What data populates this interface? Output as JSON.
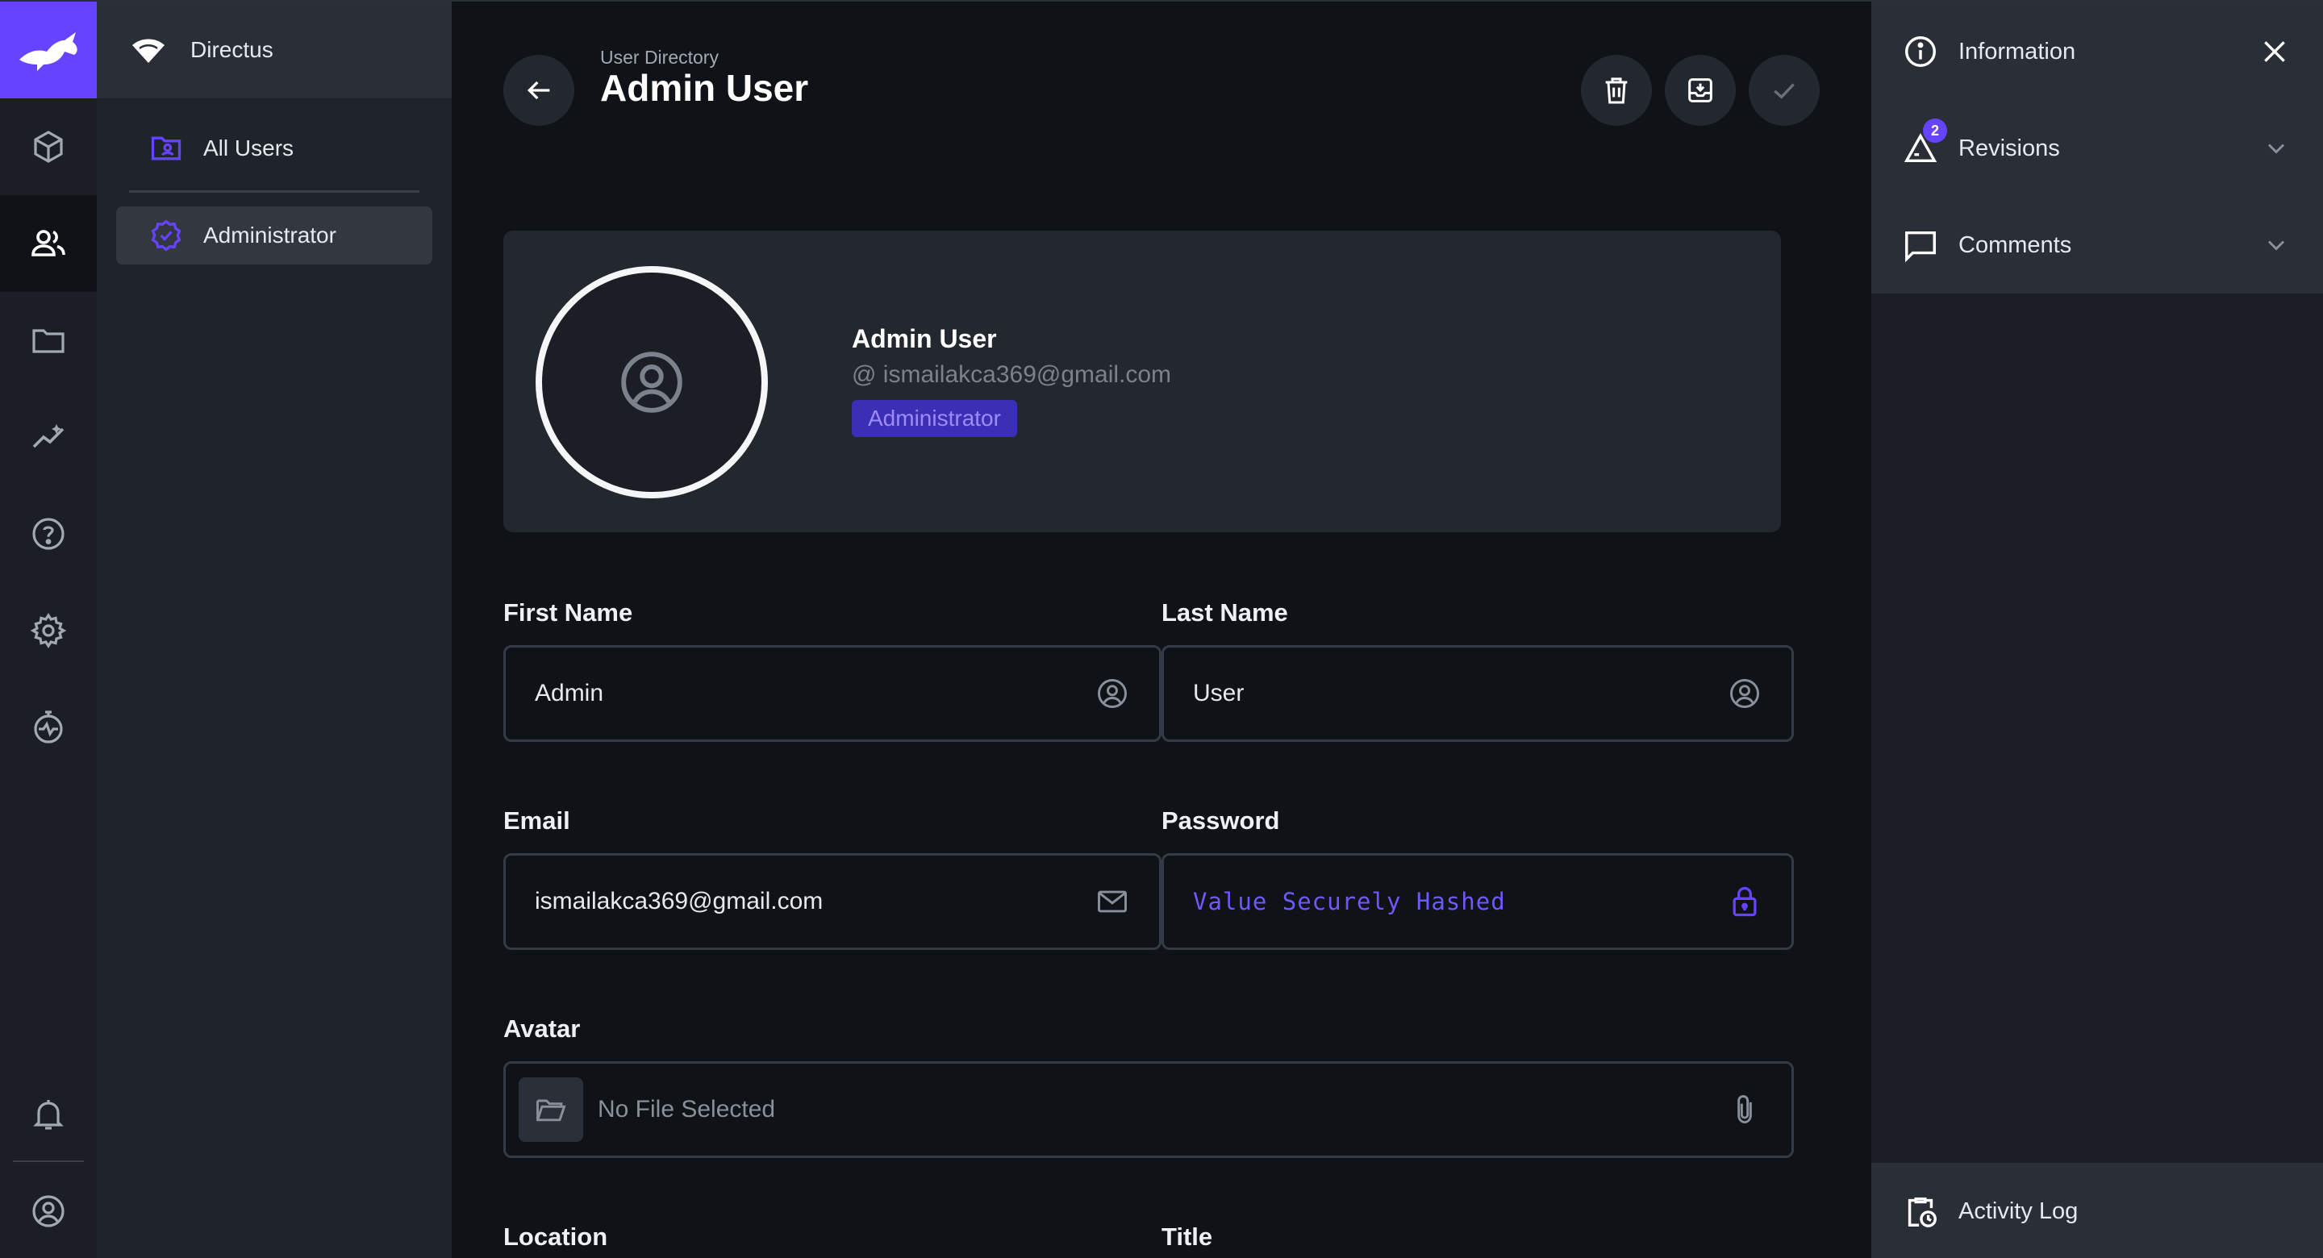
{
  "colors": {
    "accent": "#6644ff",
    "background": "#0f1216",
    "panel": "#23272e"
  },
  "project": {
    "name": "Directus"
  },
  "modules": [
    {
      "icon": "box-icon",
      "label": "content"
    },
    {
      "icon": "users-icon",
      "label": "users",
      "active": true
    },
    {
      "icon": "folder-icon",
      "label": "files"
    },
    {
      "icon": "insights-icon",
      "label": "insights"
    },
    {
      "icon": "help-icon",
      "label": "help"
    },
    {
      "icon": "gear-icon",
      "label": "settings"
    },
    {
      "icon": "activity-icon",
      "label": "activity"
    }
  ],
  "navigation": {
    "items": [
      {
        "label": "All Users",
        "icon": "folder-user-icon"
      },
      {
        "label": "Administrator",
        "icon": "verified-badge-icon",
        "active": true
      }
    ]
  },
  "header": {
    "breadcrumb": "User Directory",
    "title": "Admin User"
  },
  "profile": {
    "name": "Admin User",
    "email": "@ ismailakca369@gmail.com",
    "role": "Administrator"
  },
  "fields": {
    "first_name": {
      "label": "First Name",
      "value": "Admin"
    },
    "last_name": {
      "label": "Last Name",
      "value": "User"
    },
    "email": {
      "label": "Email",
      "value": "ismailakca369@gmail.com"
    },
    "password": {
      "label": "Password",
      "value": "Value Securely Hashed"
    },
    "avatar": {
      "label": "Avatar",
      "placeholder": "No File Selected"
    },
    "location": {
      "label": "Location"
    },
    "title": {
      "label": "Title"
    }
  },
  "sidebar": {
    "information": "Information",
    "revisions": "Revisions",
    "revisions_count": "2",
    "comments": "Comments",
    "activity_log": "Activity Log"
  }
}
